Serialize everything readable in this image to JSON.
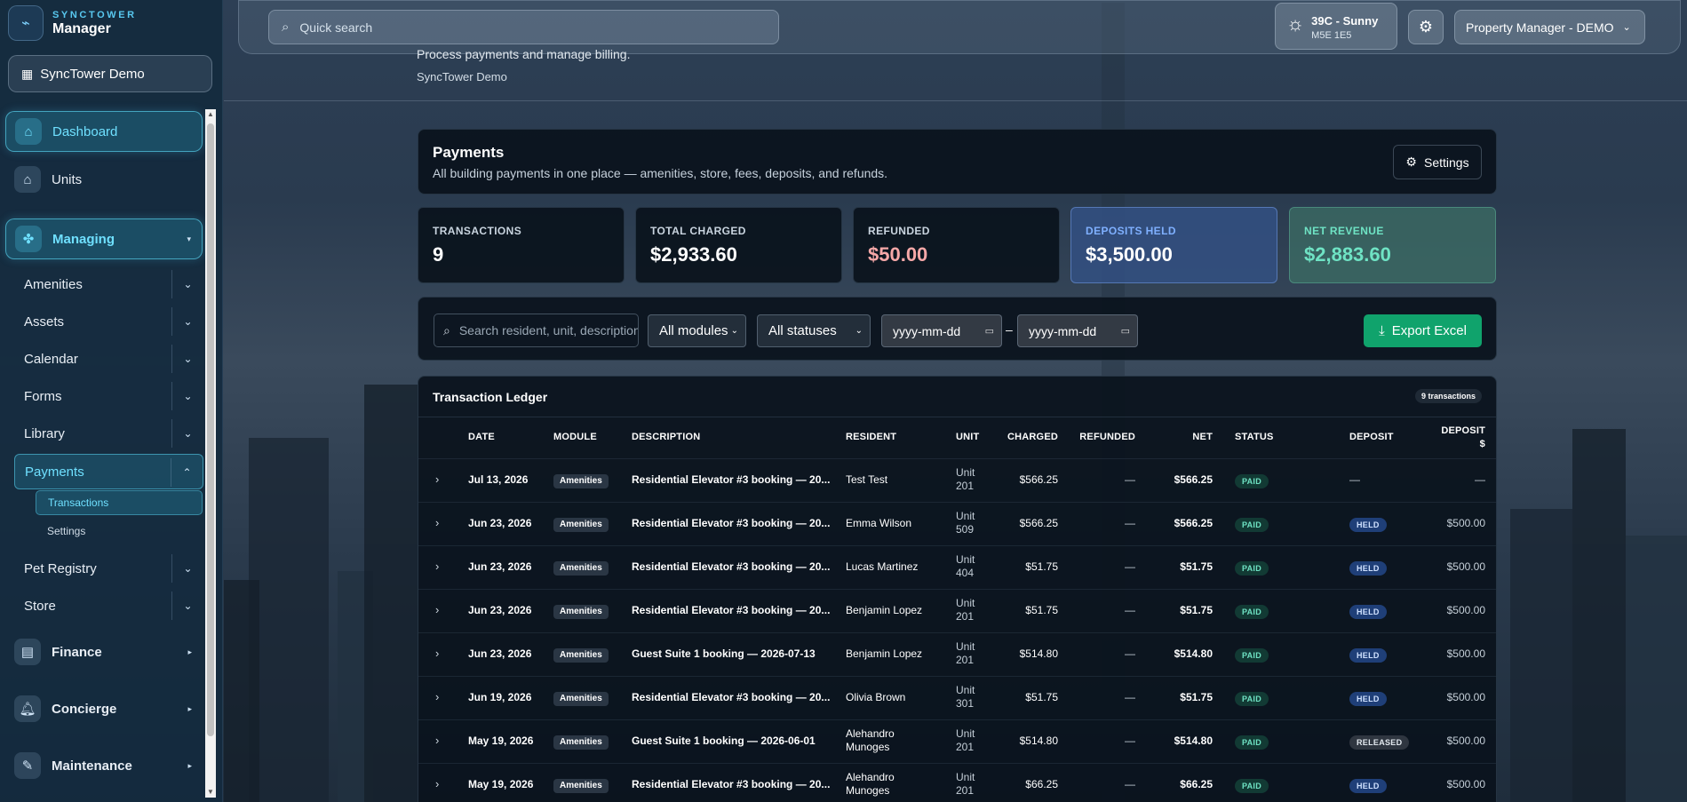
{
  "brand": {
    "tagline": "SYNCTOWER",
    "name": "Manager"
  },
  "org_button": {
    "label": "SyncTower Demo"
  },
  "sidebar": {
    "dashboard": "Dashboard",
    "units": "Units",
    "managing": "Managing",
    "managing_items": [
      "Amenities",
      "Assets",
      "Calendar",
      "Forms",
      "Library",
      "Payments",
      "Pet Registry",
      "Store"
    ],
    "payments_children": [
      "Transactions",
      "Settings"
    ],
    "finance": "Finance",
    "concierge": "Concierge",
    "maintenance": "Maintenance"
  },
  "topbar": {
    "search_placeholder": "Quick search",
    "weather_temp": "39C - Sunny",
    "weather_postal": "M5E 1E5",
    "role": "Property Manager - DEMO"
  },
  "page": {
    "subtitle": "Process payments and manage billing.",
    "org": "SyncTower Demo"
  },
  "payments_header": {
    "title": "Payments",
    "description": "All building payments in one place — amenities, store, fees, deposits, and refunds.",
    "settings_label": "Settings"
  },
  "stats": {
    "transactions": {
      "label": "TRANSACTIONS",
      "value": "9"
    },
    "total_charged": {
      "label": "TOTAL CHARGED",
      "value": "$2,933.60"
    },
    "refunded": {
      "label": "REFUNDED",
      "value": "$50.00"
    },
    "deposits_held": {
      "label": "DEPOSITS HELD",
      "value": "$3,500.00"
    },
    "net_revenue": {
      "label": "NET REVENUE",
      "value": "$2,883.60"
    }
  },
  "filters": {
    "search_placeholder": "Search resident, unit, description",
    "module": "All modules",
    "status": "All statuses",
    "date_from": "yyyy-mm-dd",
    "date_to": "yyyy-mm-dd",
    "separator": "–",
    "export_label": "Export Excel"
  },
  "ledger": {
    "title": "Transaction Ledger",
    "count_badge": "9 transactions",
    "columns": {
      "date": "DATE",
      "module": "MODULE",
      "description": "DESCRIPTION",
      "resident": "RESIDENT",
      "unit": "UNIT",
      "charged": "CHARGED",
      "refunded": "REFUNDED",
      "net": "NET",
      "status": "STATUS",
      "deposit": "DEPOSIT",
      "deposit_amt_1": "DEPOSIT",
      "deposit_amt_2": "$"
    },
    "rows": [
      {
        "date": "Jul 13, 2026",
        "module": "Amenities",
        "description": "Residential Elevator #3 booking — 20...",
        "resident_1": "Test Test",
        "resident_2": "",
        "unit_1": "Unit",
        "unit_2": "201",
        "charged": "$566.25",
        "refunded": "—",
        "net": "$566.25",
        "status": "PAID",
        "deposit": "—",
        "deposit_amt": "—"
      },
      {
        "date": "Jun 23, 2026",
        "module": "Amenities",
        "description": "Residential Elevator #3 booking — 20...",
        "resident_1": "Emma Wilson",
        "resident_2": "",
        "unit_1": "Unit",
        "unit_2": "509",
        "charged": "$566.25",
        "refunded": "—",
        "net": "$566.25",
        "status": "PAID",
        "deposit": "HELD",
        "deposit_amt": "$500.00"
      },
      {
        "date": "Jun 23, 2026",
        "module": "Amenities",
        "description": "Residential Elevator #3 booking — 20...",
        "resident_1": "Lucas Martinez",
        "resident_2": "",
        "unit_1": "Unit",
        "unit_2": "404",
        "charged": "$51.75",
        "refunded": "—",
        "net": "$51.75",
        "status": "PAID",
        "deposit": "HELD",
        "deposit_amt": "$500.00"
      },
      {
        "date": "Jun 23, 2026",
        "module": "Amenities",
        "description": "Residential Elevator #3 booking — 20...",
        "resident_1": "Benjamin Lopez",
        "resident_2": "",
        "unit_1": "Unit",
        "unit_2": "201",
        "charged": "$51.75",
        "refunded": "—",
        "net": "$51.75",
        "status": "PAID",
        "deposit": "HELD",
        "deposit_amt": "$500.00"
      },
      {
        "date": "Jun 23, 2026",
        "module": "Amenities",
        "description": "Guest Suite 1 booking — 2026-07-13",
        "resident_1": "Benjamin Lopez",
        "resident_2": "",
        "unit_1": "Unit",
        "unit_2": "201",
        "charged": "$514.80",
        "refunded": "—",
        "net": "$514.80",
        "status": "PAID",
        "deposit": "HELD",
        "deposit_amt": "$500.00"
      },
      {
        "date": "Jun 19, 2026",
        "module": "Amenities",
        "description": "Residential Elevator #3 booking — 20...",
        "resident_1": "Olivia Brown",
        "resident_2": "",
        "unit_1": "Unit",
        "unit_2": "301",
        "charged": "$51.75",
        "refunded": "—",
        "net": "$51.75",
        "status": "PAID",
        "deposit": "HELD",
        "deposit_amt": "$500.00"
      },
      {
        "date": "May 19, 2026",
        "module": "Amenities",
        "description": "Guest Suite 1 booking — 2026-06-01",
        "resident_1": "Alehandro",
        "resident_2": "Munoges",
        "unit_1": "Unit",
        "unit_2": "201",
        "charged": "$514.80",
        "refunded": "—",
        "net": "$514.80",
        "status": "PAID",
        "deposit": "RELEASED",
        "deposit_amt": "$500.00"
      },
      {
        "date": "May 19, 2026",
        "module": "Amenities",
        "description": "Residential Elevator #3 booking — 20...",
        "resident_1": "Alehandro",
        "resident_2": "Munoges",
        "unit_1": "Unit",
        "unit_2": "201",
        "charged": "$66.25",
        "refunded": "—",
        "net": "$66.25",
        "status": "PAID",
        "deposit": "HELD",
        "deposit_amt": "$500.00"
      }
    ]
  }
}
